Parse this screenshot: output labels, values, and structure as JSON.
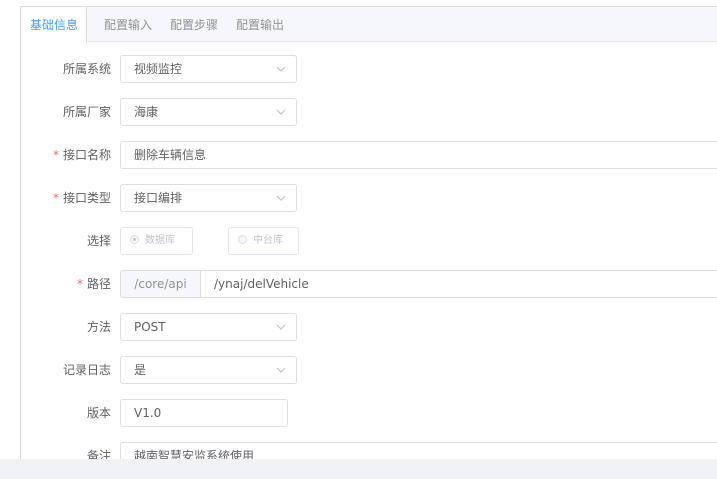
{
  "tabs": [
    {
      "label": "基础信息",
      "active": true
    },
    {
      "label": "配置输入",
      "active": false
    },
    {
      "label": "配置步骤",
      "active": false
    },
    {
      "label": "配置输出",
      "active": false
    }
  ],
  "form": {
    "system": {
      "label": "所属系统",
      "value": "视频监控"
    },
    "vendor": {
      "label": "所属厂家",
      "value": "海康"
    },
    "name": {
      "label": "接口名称",
      "value": "删除车辆信息",
      "required": true
    },
    "type": {
      "label": "接口类型",
      "value": "接口编排",
      "required": true
    },
    "choice": {
      "label": "选择",
      "options": [
        "数据库",
        "中台库"
      ],
      "selected": "数据库"
    },
    "path": {
      "label": "路径",
      "prefix": "/core/api",
      "value": "/ynaj/delVehicle",
      "required": true
    },
    "method": {
      "label": "方法",
      "value": "POST"
    },
    "log": {
      "label": "记录日志",
      "value": "是"
    },
    "version": {
      "label": "版本",
      "value": "V1.0"
    },
    "remark": {
      "label": "备注",
      "value": "越南智慧安监系统使用"
    }
  },
  "required_mark": "*",
  "colors": {
    "accent": "#409eff",
    "required": "#f56c6c",
    "border": "#dcdfe6"
  }
}
